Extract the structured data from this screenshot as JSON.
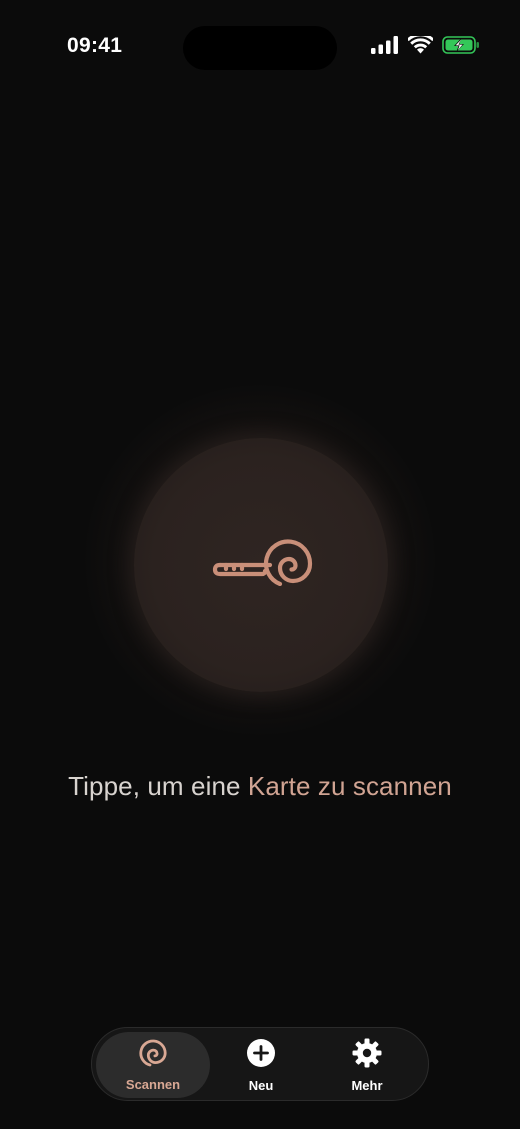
{
  "status_bar": {
    "time": "09:41",
    "icons": [
      "cellular-signal-icon",
      "wifi-icon",
      "battery-charging-icon"
    ],
    "battery_color": "#34c759"
  },
  "main": {
    "scan_button_icon": "key-spiral-icon",
    "prompt_prefix": "Tippe, um eine ",
    "prompt_accent": "Karte zu scannen",
    "accent_color": "#d1a493"
  },
  "tab_bar": {
    "tabs": [
      {
        "label": "Scannen",
        "icon": "spiral-icon",
        "active": true
      },
      {
        "label": "Neu",
        "icon": "plus-circle-icon",
        "active": false
      },
      {
        "label": "Mehr",
        "icon": "gear-icon",
        "active": false
      }
    ]
  }
}
